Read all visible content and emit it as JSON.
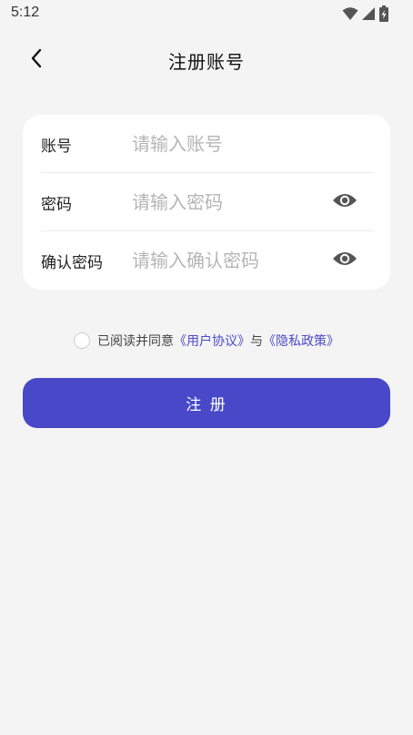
{
  "status_bar": {
    "time": "5:12",
    "icons": [
      "wifi-icon",
      "cellular-signal-icon",
      "battery-charging-icon"
    ]
  },
  "nav": {
    "back_icon": "chevron-left-icon",
    "title": "注册账号"
  },
  "form": {
    "account": {
      "label": "账号",
      "placeholder": "请输入账号",
      "value": ""
    },
    "password": {
      "label": "密码",
      "placeholder": "请输入密码",
      "value": "",
      "toggle_icon": "eye-icon"
    },
    "confirm_password": {
      "label": "确认密码",
      "placeholder": "请输入确认密码",
      "value": "",
      "toggle_icon": "eye-icon"
    }
  },
  "agreement": {
    "checked": false,
    "prefix": "已阅读并同意",
    "user_agreement_link": "《用户协议》",
    "conjunction": "与",
    "privacy_policy_link": "《隐私政策》"
  },
  "register_button": {
    "label": "注 册"
  },
  "colors": {
    "primary": "#4848c9",
    "link": "#4a4ac9",
    "background": "#f4f4f4",
    "card": "#ffffff",
    "placeholder": "#b5b5b5"
  }
}
